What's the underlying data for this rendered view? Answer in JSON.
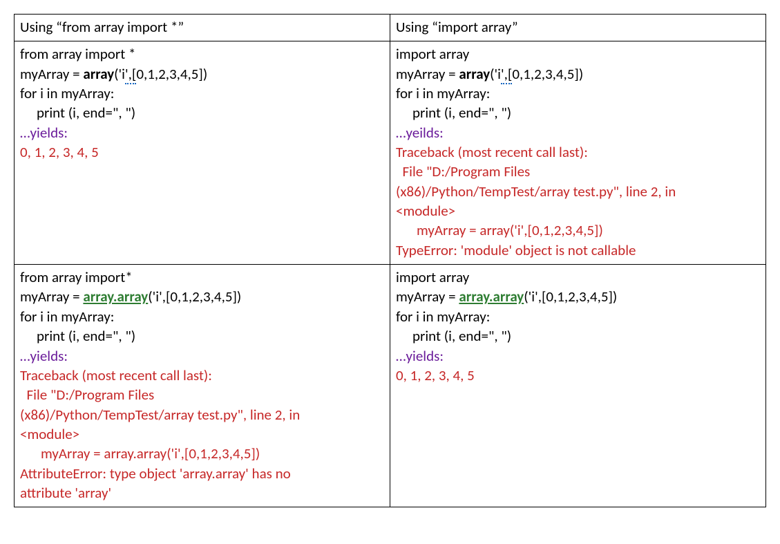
{
  "headers": {
    "left": "Using “from array import *”",
    "right": "Using “import array”"
  },
  "cells": {
    "tl": {
      "l1": "from array import *",
      "l2a": "myArray = ",
      "l2b": "array",
      "l2c": "('i",
      "l2d": "',[",
      "l2e": "0,1,2,3,4,5])",
      "l3": "for i in myArray:",
      "l4": "print (i, end=\", \")",
      "yields": "…yields:",
      "out": "0, 1, 2, 3, 4, 5"
    },
    "tr": {
      "l1": "import array",
      "l2a": "myArray = ",
      "l2b": "array",
      "l2c": "('i",
      "l2d": "',[",
      "l2e": "0,1,2,3,4,5])",
      "l3": "for i in myArray:",
      "l4": "print (i, end=\", \")",
      "yields": "…yeilds:",
      "e1": "Traceback (most recent call last):",
      "e2": "File \"D:/Program Files",
      "e3": "(x86)/Python/TempTest/array test.py\", line 2, in",
      "e4": "<module>",
      "e5": "myArray = array('i',[0,1,2,3,4,5])",
      "e6": "TypeError: 'module' object is not callable"
    },
    "bl": {
      "l1": "from array import*",
      "l2a": "myArray = ",
      "l2b": "array.array",
      "l2c": "('i',[0,1,2,3,4,5])",
      "l3": "for i in myArray:",
      "l4": "print (i, end=\", \")",
      "yields": "…yields:",
      "e1": "Traceback (most recent call last):",
      "e2": "File \"D:/Program Files",
      "e3": "(x86)/Python/TempTest/array test.py\", line 2, in",
      "e4": "<module>",
      "e5": "myArray = array.array('i',[0,1,2,3,4,5])",
      "e6": "AttributeError: type object 'array.array' has no",
      "e7": "attribute 'array'"
    },
    "br": {
      "l1": "import array",
      "l2a": "myArray = ",
      "l2b": "array.array",
      "l2c": "('i',[0,1,2,3,4,5])",
      "l3": "for i in myArray:",
      "l4": "print (i, end=\", \")",
      "yields": "…yields:",
      "out": "0, 1, 2, 3, 4, 5"
    }
  }
}
